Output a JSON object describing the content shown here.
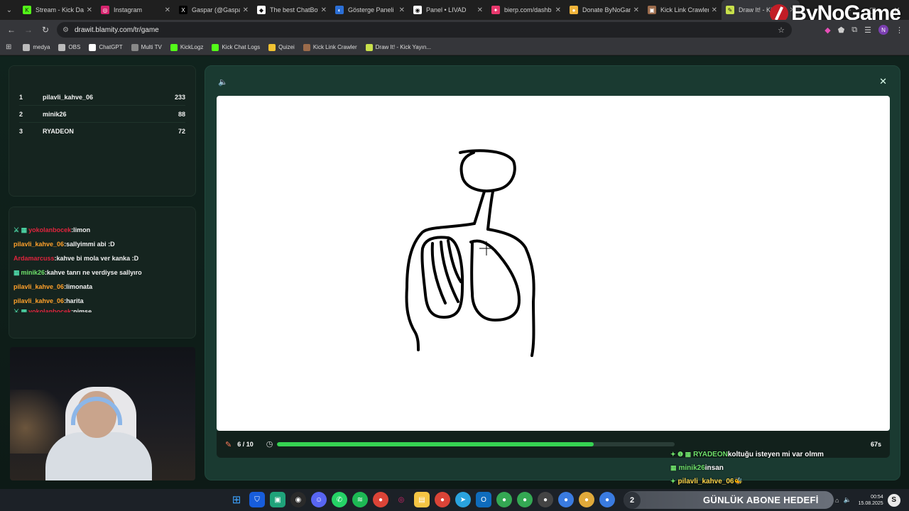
{
  "browser": {
    "tabs": [
      {
        "title": "Stream - Kick Dash",
        "color": "#53fc18",
        "glyph": "K"
      },
      {
        "title": "Instagram",
        "color": "#d6246e",
        "glyph": "◎"
      },
      {
        "title": "Gaspar (@Gaspar",
        "color": "#000000",
        "glyph": "X"
      },
      {
        "title": "The best ChatBot",
        "color": "#ffffff",
        "glyph": "◆"
      },
      {
        "title": "Gösterge Paneli",
        "color": "#2b6fd6",
        "glyph": "◐"
      },
      {
        "title": "Panel • LIVAD",
        "color": "#ffffff",
        "glyph": "◉"
      },
      {
        "title": "bierp.com/dashb",
        "color": "#e8386d",
        "glyph": "✦"
      },
      {
        "title": "Donate ByNoGam",
        "color": "#f1b43a",
        "glyph": "●"
      },
      {
        "title": "Kick Link Crawler",
        "color": "#9b6b4b",
        "glyph": "▣"
      },
      {
        "title": "Draw It! - Kick",
        "color": "#c8e04b",
        "glyph": "✎"
      }
    ],
    "url": "drawit.blamity.com/tr/game",
    "bookmarks": [
      {
        "label": "medya",
        "color": "#bbbbbb"
      },
      {
        "label": "OBS",
        "color": "#bbbbbb"
      },
      {
        "label": "ChatGPT",
        "color": "#ffffff"
      },
      {
        "label": "Multi TV",
        "color": "#888888"
      },
      {
        "label": "KickLogz",
        "color": "#53fc18"
      },
      {
        "label": "Kick Chat Logs",
        "color": "#53fc18"
      },
      {
        "label": "Quizei",
        "color": "#f1c232"
      },
      {
        "label": "Kick Link Crawler",
        "color": "#9b6b4b"
      },
      {
        "label": "Draw It! - Kick Yayın...",
        "color": "#c8e04b"
      }
    ],
    "profile_initial": "N"
  },
  "overlay_logo": {
    "text": "ByNoGame"
  },
  "leaderboard": [
    {
      "rank": "1",
      "name": "pilavli_kahve_06",
      "score": "233"
    },
    {
      "rank": "2",
      "name": "minik26",
      "score": "88"
    },
    {
      "rank": "3",
      "name": "RYADEON",
      "score": "72"
    }
  ],
  "chat_log": [
    {
      "icons": "⚔ ▦",
      "user": "yokolanbocek",
      "user_color": "#e0243d",
      "message": "limon"
    },
    {
      "icons": "",
      "user": "pilavli_kahve_06",
      "user_color": "#ffa12b",
      "message": "sallyimmi abi :D"
    },
    {
      "icons": "",
      "user": "Ardamarcuss",
      "user_color": "#e0243d",
      "message": "kahve bi mola ver kanka :D"
    },
    {
      "icons": "▦",
      "user": "minik26",
      "user_color": "#6ee06a",
      "message": "kahve tanrı ne verdiyse sallyıro"
    },
    {
      "icons": "",
      "user": "pilavli_kahve_06",
      "user_color": "#ffa12b",
      "message": "limonata"
    },
    {
      "icons": "",
      "user": "pilavli_kahve_06",
      "user_color": "#ffa12b",
      "message": "harita"
    },
    {
      "icons": "⚔ ▦",
      "user": "yokolanbocek",
      "user_color": "#e0243d",
      "message": "nimse"
    }
  ],
  "game": {
    "round_label": "6 / 10",
    "timer_label": "67s",
    "progress": 0.795
  },
  "overlay_chat": [
    {
      "icons": "✦ ❶ ▦",
      "user": "RYADEON",
      "user_color": "#6ee06a",
      "message": "koltuğu isteyen mi var olmm"
    },
    {
      "icons": "▦",
      "user": "minik26",
      "user_color": "#6ee06a",
      "message": "insan"
    },
    {
      "icons": "✦",
      "user": "pilavli_kahve_06",
      "user_color": "#ffd54a",
      "message": "🐝"
    }
  ],
  "taskbar": {
    "goal_number": "2",
    "goal_text": "GÜNLÜK ABONE HEDEFİ",
    "time": "00:54",
    "date": "15.08.2025",
    "badge": "S"
  }
}
